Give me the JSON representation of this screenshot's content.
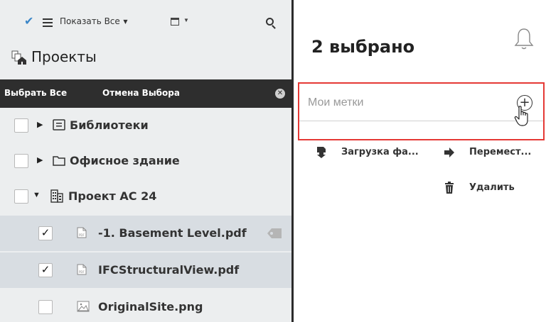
{
  "toolbar": {
    "show_all_label": "Показать Все"
  },
  "projects": {
    "title": "Проекты"
  },
  "selection_bar": {
    "select_all": "Выбрать Все",
    "cancel_selection": "Отмена Выбора"
  },
  "tree": [
    {
      "label": "Библиотеки",
      "checked": false,
      "expanded": false,
      "icon": "library-icon"
    },
    {
      "label": "Офисное здание",
      "checked": false,
      "expanded": false,
      "icon": "folder-icon"
    },
    {
      "label": "Проект АС 24",
      "checked": false,
      "expanded": true,
      "icon": "building-icon"
    },
    {
      "label": "-1. Basement Level.pdf",
      "checked": true,
      "icon": "pdf-file-icon",
      "tagged": true
    },
    {
      "label": "IFCStructuralView.pdf",
      "checked": true,
      "icon": "pdf-file-icon"
    },
    {
      "label": "OriginalSite.png",
      "checked": false,
      "icon": "image-file-icon"
    }
  ],
  "details": {
    "selected_count": "2 выбрано",
    "tags_placeholder": "Мои метки",
    "actions": {
      "download": "Загрузка фа...",
      "move": "Перемест...",
      "delete": "Удалить"
    }
  },
  "colors": {
    "highlight_border": "#e53935",
    "selection_bar_bg": "#2e2e2e",
    "selected_row_bg": "#d8dde2",
    "panel_bg": "#eceeef",
    "check_accent": "#3a86c8"
  }
}
